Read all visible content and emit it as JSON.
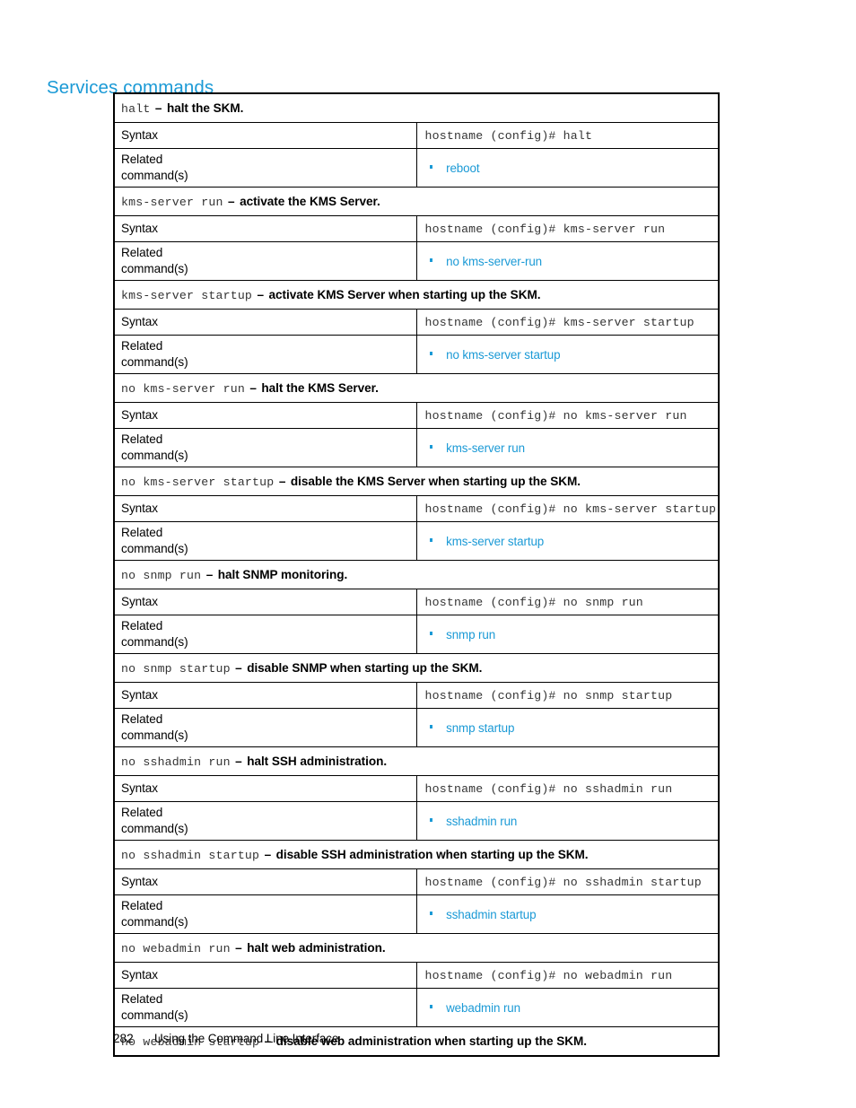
{
  "page": {
    "heading": "Services commands",
    "footer_page_number": "282",
    "footer_title": "Using the Command Line Interface",
    "accent_color": "#1b9ad6",
    "mono_color": "#333333"
  },
  "labels": {
    "syntax": "Syntax",
    "related": "Related command(s)"
  },
  "commands": [
    {
      "name": "halt",
      "dash": "–",
      "description": "halt the SKM.",
      "syntax": "hostname (config)# halt",
      "related": [
        "reboot"
      ]
    },
    {
      "name": "kms-server run",
      "dash": "–",
      "description": "activate the KMS Server.",
      "syntax": "hostname (config)# kms-server run",
      "related": [
        "no kms-server-run"
      ]
    },
    {
      "name": "kms-server startup",
      "dash": "–",
      "description": "activate KMS Server when starting up the SKM.",
      "syntax": "hostname (config)# kms-server startup",
      "related": [
        "no kms-server startup"
      ]
    },
    {
      "name": "no kms-server run",
      "dash": "–",
      "description": "halt the KMS Server.",
      "syntax": "hostname (config)# no kms-server run",
      "related": [
        "kms-server run"
      ]
    },
    {
      "name": "no kms-server startup",
      "dash": "–",
      "description": "disable the KMS Server when starting up the SKM.",
      "syntax": "hostname (config)# no kms-server startup",
      "related": [
        "kms-server startup"
      ]
    },
    {
      "name": "no snmp run",
      "dash": "–",
      "description": "halt SNMP monitoring.",
      "syntax": "hostname (config)# no snmp run",
      "related": [
        "snmp run"
      ]
    },
    {
      "name": "no snmp startup",
      "dash": "–",
      "description": "disable SNMP when starting up the SKM.",
      "syntax": "hostname (config)# no snmp startup",
      "related": [
        "snmp startup"
      ]
    },
    {
      "name": "no sshadmin run",
      "dash": "–",
      "description": "halt SSH administration.",
      "syntax": "hostname (config)# no sshadmin run",
      "related": [
        "sshadmin run"
      ]
    },
    {
      "name": "no sshadmin startup",
      "dash": "–",
      "description": "disable SSH administration when starting up the SKM.",
      "syntax": "hostname (config)# no sshadmin startup",
      "related": [
        "sshadmin startup"
      ]
    },
    {
      "name": "no webadmin run",
      "dash": "–",
      "description": "halt web administration.",
      "syntax": "hostname (config)# no webadmin run",
      "related": [
        "webadmin run"
      ]
    },
    {
      "name": "no webadmin startup",
      "dash": "–",
      "description": "disable web administration when starting up the SKM.",
      "syntax": null,
      "related": []
    }
  ]
}
